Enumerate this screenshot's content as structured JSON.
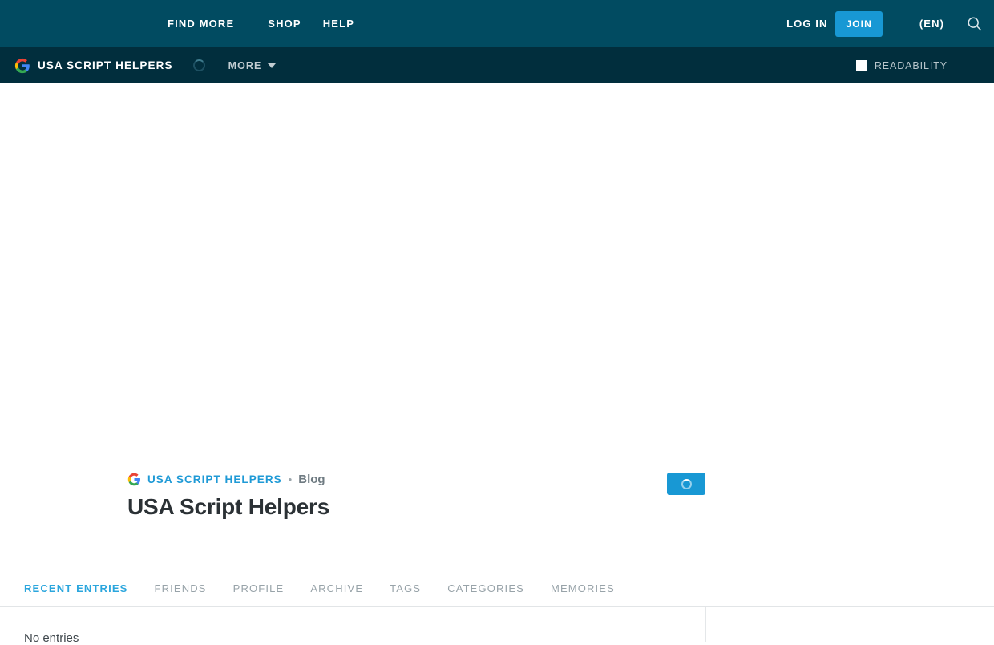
{
  "topbar": {
    "nav": [
      {
        "label": "FIND MORE",
        "name": "find-more"
      },
      {
        "label": "SHOP",
        "name": "shop"
      },
      {
        "label": "HELP",
        "name": "help"
      }
    ],
    "login_label": "LOG IN",
    "join_label": "JOIN",
    "language_label": "(EN)",
    "search_icon": "search-icon",
    "bg_color": "#014b61",
    "join_color": "#1898d4"
  },
  "subbar": {
    "logo_icon": "google-g-icon",
    "brand_name": "USA SCRIPT HELPERS",
    "spinner_icon": "loading-spinner-icon",
    "more_label": "MORE",
    "caret_icon": "chevron-down-icon",
    "readability_label": "READABILITY",
    "readability_checked": false,
    "bg_color": "#012e3d"
  },
  "profile": {
    "breadcrumb": {
      "logo_icon": "google-g-icon",
      "site": "USA SCRIPT HELPERS",
      "separator": "•",
      "section": "Blog"
    },
    "title": "USA Script Helpers",
    "action_button": {
      "name": "loading-action-button",
      "icon": "loading-spinner-icon",
      "color": "#1898d4"
    }
  },
  "tabs": [
    {
      "label": "RECENT ENTRIES",
      "name": "tab-recent-entries",
      "active": true
    },
    {
      "label": "FRIENDS",
      "name": "tab-friends",
      "active": false
    },
    {
      "label": "PROFILE",
      "name": "tab-profile",
      "active": false
    },
    {
      "label": "ARCHIVE",
      "name": "tab-archive",
      "active": false
    },
    {
      "label": "TAGS",
      "name": "tab-tags",
      "active": false
    },
    {
      "label": "CATEGORIES",
      "name": "tab-categories",
      "active": false
    },
    {
      "label": "MEMORIES",
      "name": "tab-memories",
      "active": false
    }
  ],
  "content": {
    "empty_message": "No entries"
  }
}
